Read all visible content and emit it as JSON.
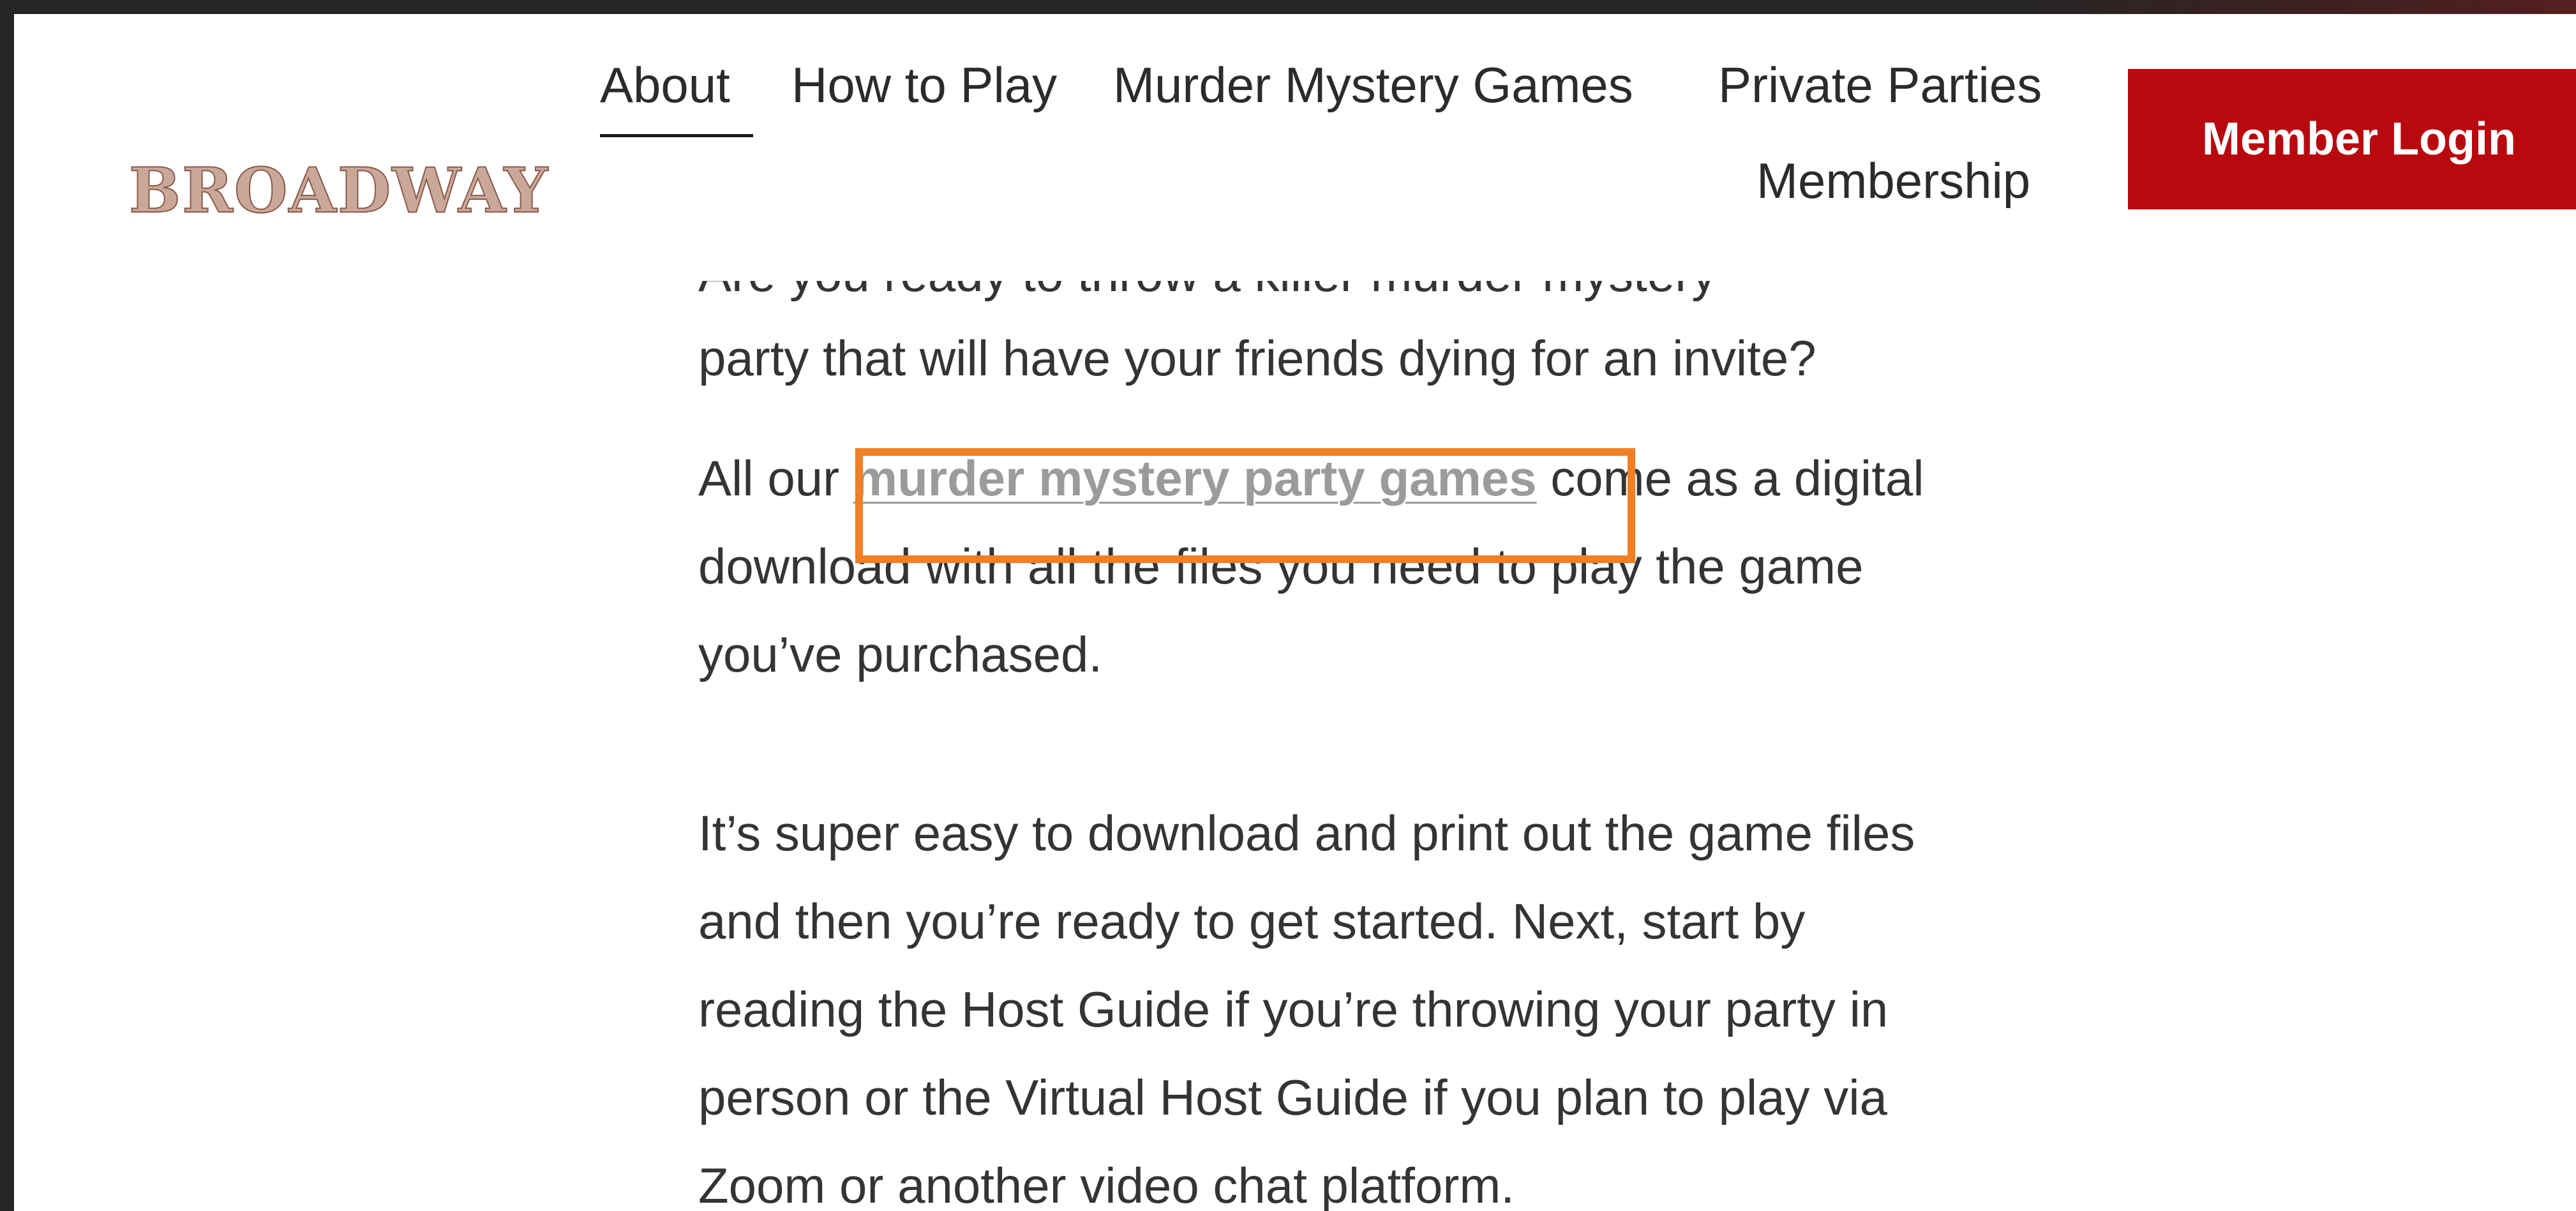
{
  "header": {
    "logo_text": "BROADWAY",
    "nav": {
      "about": "About",
      "how_to_play": "How to Play",
      "murder_mystery_games": "Murder Mystery Games",
      "private_parties": "Private Parties",
      "membership": "Membership"
    },
    "login_button": "Member Login"
  },
  "content": {
    "cut_line": "Are you ready to throw a killer murder mystery",
    "para1": "party that will have your friends dying for an invite?",
    "para2_before": "All our ",
    "para2_link": "murder mystery party games",
    "para2_after": " come as a digital download with all the files you need to play the game you’ve purchased.",
    "para3": "It’s super easy to download and print out the game files and then you’re ready to get started. Next, start by reading the Host Guide if you’re throwing your party in person or the Virtual Host Guide if you plan to play via Zoom or another video chat platform."
  },
  "colors": {
    "brand_red": "#b8090f",
    "highlight_orange": "#f07f25",
    "link_gray": "#9b9b9b",
    "text": "#343434"
  }
}
